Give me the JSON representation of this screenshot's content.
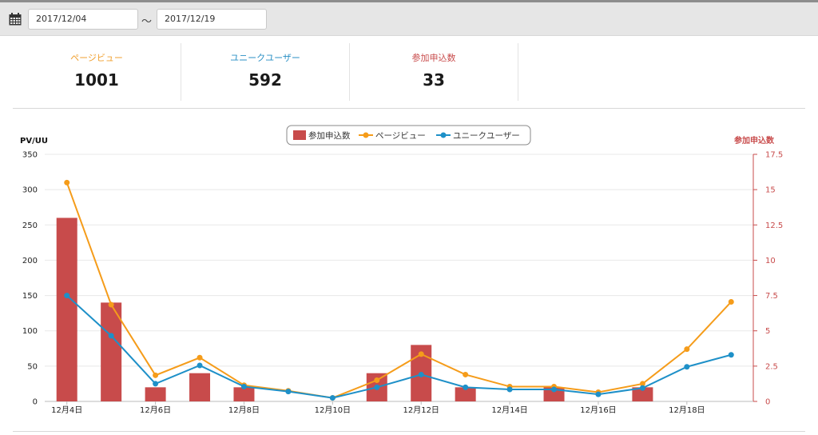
{
  "date_range": {
    "start": "2017/12/04",
    "separator": "〜",
    "end": "2017/12/19"
  },
  "icons": {
    "calendar": "calendar-icon"
  },
  "stats": [
    {
      "label": "ページビュー",
      "value": "1001",
      "color": "#f0a030"
    },
    {
      "label": "ユニークユーザー",
      "value": "592",
      "color": "#2a8fc4"
    },
    {
      "label": "参加申込数",
      "value": "33",
      "color": "#c84b4b"
    }
  ],
  "colors": {
    "bar": "#c84b4b",
    "pageview_line": "#f59c1a",
    "uu_line": "#1e90c8",
    "right_axis": "#c84b4b"
  },
  "chart_data": {
    "type": "bar",
    "categories": [
      "12月4日",
      "12月5日",
      "12月6日",
      "12月7日",
      "12月8日",
      "12月9日",
      "12月10日",
      "12月11日",
      "12月12日",
      "12月13日",
      "12月14日",
      "12月15日",
      "12月16日",
      "12月17日",
      "12月18日",
      "12月19日"
    ],
    "x_tick_labels": [
      "12月4日",
      "12月6日",
      "12月8日",
      "12月10日",
      "12月12日",
      "12月14日",
      "12月16日",
      "12月18日"
    ],
    "series": [
      {
        "name": "参加申込数",
        "type": "bar",
        "axis": "right",
        "values": [
          13,
          7,
          1,
          2,
          1,
          0,
          0,
          2,
          4,
          1,
          0,
          1,
          0,
          1,
          0,
          0
        ]
      },
      {
        "name": "ページビュー",
        "type": "line",
        "axis": "left",
        "values": [
          310,
          137,
          37,
          62,
          23,
          15,
          5,
          30,
          67,
          38,
          21,
          21,
          13,
          25,
          74,
          141
        ]
      },
      {
        "name": "ユニークユーザー",
        "type": "line",
        "axis": "left",
        "values": [
          150,
          93,
          25,
          51,
          21,
          14,
          5,
          20,
          38,
          20,
          17,
          17,
          10,
          19,
          49,
          66
        ]
      }
    ],
    "ylabel_left": "PV/UU",
    "ylabel_right": "参加申込数",
    "ylim_left": [
      0,
      350
    ],
    "ylim_right": [
      0,
      17.5
    ],
    "yticks_left": [
      "0",
      "50",
      "100",
      "150",
      "200",
      "250",
      "300",
      "350"
    ],
    "yticks_right": [
      "0",
      "2.5",
      "5",
      "7.5",
      "10",
      "12.5",
      "15",
      "17.5"
    ],
    "grid": "horizontal",
    "legend": "top-center"
  }
}
